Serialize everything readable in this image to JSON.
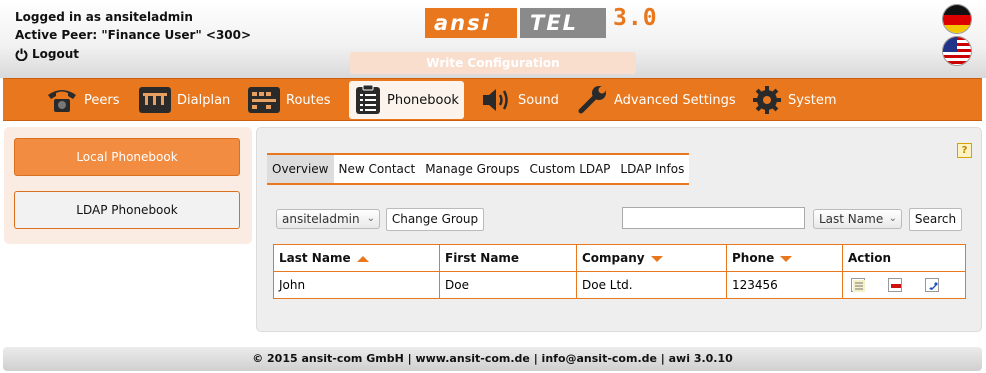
{
  "header": {
    "logged_in": "Logged in as ansiteladmin",
    "active_peer": "Active Peer: \"Finance User\" <300>",
    "logout": "Logout",
    "logo_ansi": "ansi",
    "logo_tel": "TEL",
    "logo_version": "3.0",
    "write_config": "Write Configuration",
    "flags": [
      "german-flag-icon",
      "us-flag-icon"
    ]
  },
  "nav": {
    "items": [
      {
        "label": "Peers",
        "icon": "telephone-icon"
      },
      {
        "label": "Dialplan",
        "icon": "dialplan-icon"
      },
      {
        "label": "Routes",
        "icon": "routes-icon"
      },
      {
        "label": "Phonebook",
        "icon": "phonebook-icon",
        "active": true
      },
      {
        "label": "Sound",
        "icon": "speaker-icon"
      },
      {
        "label": "Advanced Settings",
        "icon": "wrench-icon"
      },
      {
        "label": "System",
        "icon": "gear-icon"
      }
    ]
  },
  "sidebar": {
    "local": "Local Phonebook",
    "ldap": "LDAP Phonebook"
  },
  "tabs": [
    "Overview",
    "New Contact",
    "Manage Groups",
    "Custom LDAP",
    "LDAP Infos"
  ],
  "toolbar": {
    "group_value": "ansiteladmin",
    "change_group": "Change Group",
    "search_value": "",
    "field_value": "Last Name",
    "search": "Search"
  },
  "table": {
    "headers": [
      "Last Name",
      "First Name",
      "Company",
      "Phone",
      "Action"
    ],
    "rows": [
      {
        "last": "John",
        "first": "Doe",
        "company": "Doe Ltd.",
        "phone": "123456"
      }
    ]
  },
  "help_label": "?",
  "footer": "© 2015 ansit-com GmbH | www.ansit-com.de | info@ansit-com.de | awi 3.0.10",
  "colors": {
    "accent": "#e8771d",
    "panel": "#eeeeee",
    "sidebar": "#faece2"
  }
}
